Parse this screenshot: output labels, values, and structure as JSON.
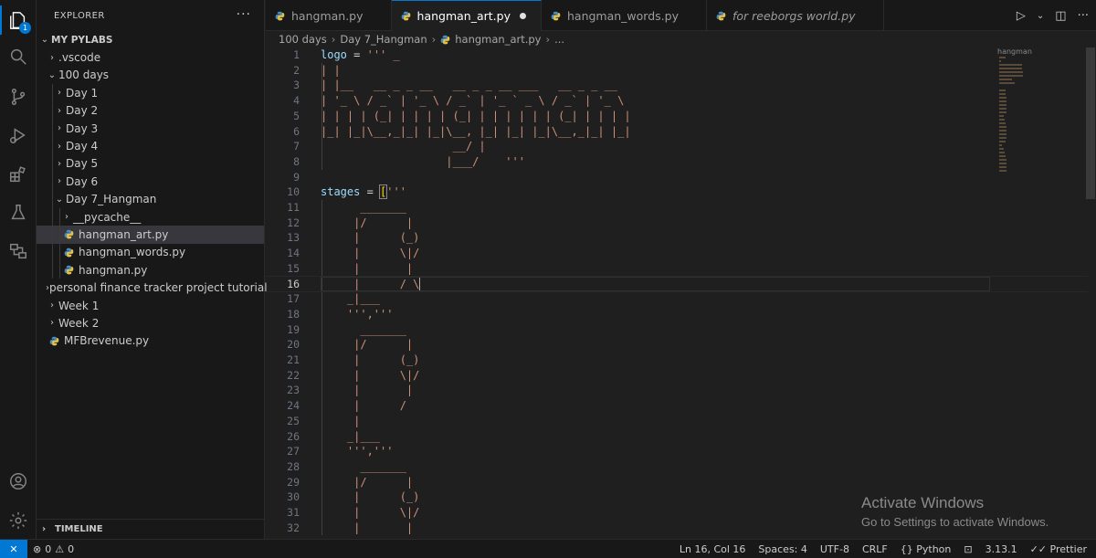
{
  "activity_bar": {
    "explorer_badge": "1"
  },
  "sidebar": {
    "title": "EXPLORER",
    "more": "···",
    "root": "MY PYLABS",
    "timeline": "TIMELINE",
    "tree": [
      {
        "label": ".vscode",
        "depth": 1,
        "kind": "folder",
        "open": false
      },
      {
        "label": "100 days",
        "depth": 1,
        "kind": "folder",
        "open": true
      },
      {
        "label": "Day 1",
        "depth": 2,
        "kind": "folder",
        "open": false
      },
      {
        "label": "Day 2",
        "depth": 2,
        "kind": "folder",
        "open": false
      },
      {
        "label": "Day 3",
        "depth": 2,
        "kind": "folder",
        "open": false
      },
      {
        "label": "Day 4",
        "depth": 2,
        "kind": "folder",
        "open": false
      },
      {
        "label": "Day 5",
        "depth": 2,
        "kind": "folder",
        "open": false
      },
      {
        "label": "Day 6",
        "depth": 2,
        "kind": "folder",
        "open": false
      },
      {
        "label": "Day 7_Hangman",
        "depth": 2,
        "kind": "folder",
        "open": true
      },
      {
        "label": "__pycache__",
        "depth": 3,
        "kind": "folder",
        "open": false
      },
      {
        "label": "hangman_art.py",
        "depth": 3,
        "kind": "py",
        "selected": true
      },
      {
        "label": "hangman_words.py",
        "depth": 3,
        "kind": "py"
      },
      {
        "label": "hangman.py",
        "depth": 3,
        "kind": "py"
      },
      {
        "label": "personal finance tracker project tutorial",
        "depth": 1,
        "kind": "folder",
        "open": false
      },
      {
        "label": "Week 1",
        "depth": 1,
        "kind": "folder",
        "open": false
      },
      {
        "label": "Week 2",
        "depth": 1,
        "kind": "folder",
        "open": false
      },
      {
        "label": "MFBrevenue.py",
        "depth": 1,
        "kind": "py"
      }
    ]
  },
  "tabs": [
    {
      "label": "hangman.py",
      "active": false,
      "italic": false
    },
    {
      "label": "hangman_art.py",
      "active": true,
      "italic": false,
      "dirty": true
    },
    {
      "label": "hangman_words.py",
      "active": false,
      "italic": false
    },
    {
      "label": "for reeborgs world.py",
      "active": false,
      "italic": true
    }
  ],
  "tab_actions": {
    "run": "▷",
    "dropdown": "⌄",
    "split": "◫",
    "more": "···"
  },
  "breadcrumb": [
    "100 days",
    "Day 7_Hangman",
    "hangman_art.py",
    "..."
  ],
  "editor": {
    "current_line": 16,
    "lines": [
      {
        "n": "1",
        "t": "logo = ''' _"
      },
      {
        "n": "2",
        "t": "| |"
      },
      {
        "n": "3",
        "t": "| |__   __ _ _ __   __ _ _ __ ___   __ _ _ __"
      },
      {
        "n": "4",
        "t": "| '_ \\ / _` | '_ \\ / _` | '_ ` _ \\ / _` | '_ \\"
      },
      {
        "n": "5",
        "t": "| | | | (_| | | | | (_| | | | | | | (_| | | | |"
      },
      {
        "n": "6",
        "t": "|_| |_|\\__,_|_| |_|\\__, |_| |_| |_|\\__,_|_| |_|"
      },
      {
        "n": "7",
        "t": "                    __/ |"
      },
      {
        "n": "8",
        "t": "                   |___/    '''"
      },
      {
        "n": "9",
        "t": ""
      },
      {
        "n": "10",
        "t": "stages = ['''"
      },
      {
        "n": "11",
        "t": "      _______"
      },
      {
        "n": "12",
        "t": "     |/      |"
      },
      {
        "n": "13",
        "t": "     |      (_)"
      },
      {
        "n": "14",
        "t": "     |      \\|/"
      },
      {
        "n": "15",
        "t": "     |       |"
      },
      {
        "n": "16",
        "t": "     |      / \\"
      },
      {
        "n": "17",
        "t": "    _|___"
      },
      {
        "n": "18",
        "t": "    ''','''"
      },
      {
        "n": "19",
        "t": "      _______"
      },
      {
        "n": "20",
        "t": "     |/      |"
      },
      {
        "n": "21",
        "t": "     |      (_)"
      },
      {
        "n": "22",
        "t": "     |      \\|/"
      },
      {
        "n": "23",
        "t": "     |       |"
      },
      {
        "n": "24",
        "t": "     |      /"
      },
      {
        "n": "25",
        "t": "     |"
      },
      {
        "n": "26",
        "t": "    _|___"
      },
      {
        "n": "27",
        "t": "    ''','''"
      },
      {
        "n": "28",
        "t": "      _______"
      },
      {
        "n": "29",
        "t": "     |/      |"
      },
      {
        "n": "30",
        "t": "     |      (_)"
      },
      {
        "n": "31",
        "t": "     |      \\|/"
      },
      {
        "n": "32",
        "t": "     |       |"
      }
    ]
  },
  "minimap": {
    "title": "hangman"
  },
  "watermark": {
    "line1": "Activate Windows",
    "line2": "Go to Settings to activate Windows."
  },
  "status_bar": {
    "errors": "0",
    "warnings": "0",
    "position": "Ln 16, Col 16",
    "spaces": "Spaces: 4",
    "encoding": "UTF-8",
    "eol": "CRLF",
    "language": "Python",
    "version": "3.13.1",
    "prettier": "Prettier"
  },
  "colors": {
    "string": "#ce9178",
    "variable": "#9cdcfe",
    "accent": "#0078d4",
    "bracket": "#ffd700",
    "python_icon": "#4b8bbe"
  }
}
